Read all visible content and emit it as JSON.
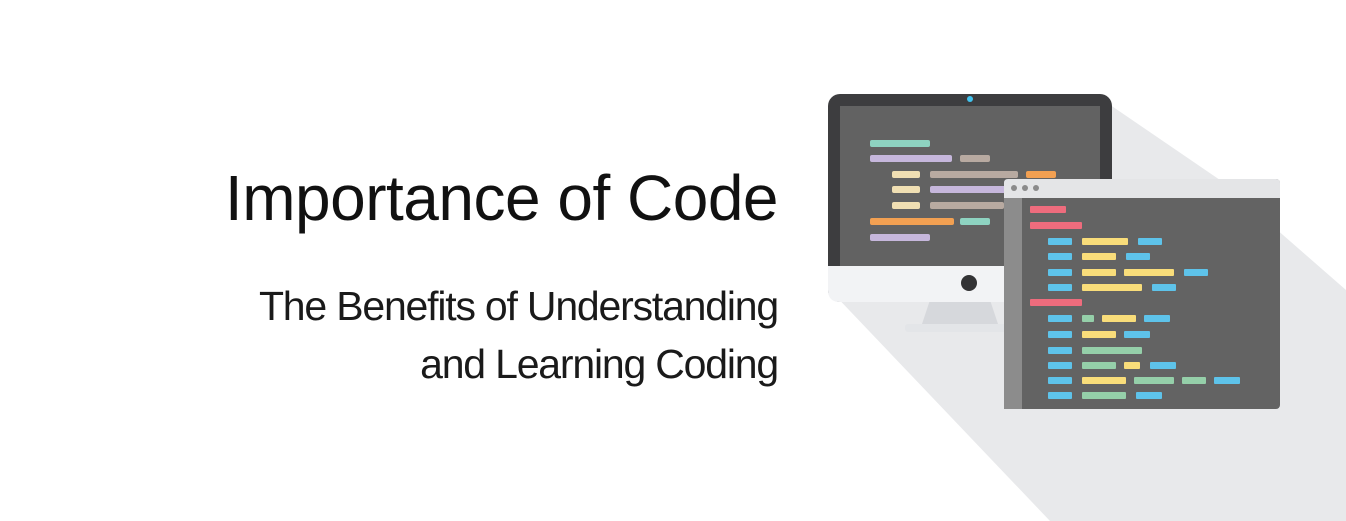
{
  "heading": {
    "title": "Importance of Code",
    "subtitle_line1": "The Benefits of Understanding",
    "subtitle_line2": "and Learning Coding"
  },
  "illustration": {
    "monitor_icon": "desktop-monitor-icon",
    "window_icon": "code-editor-window-icon",
    "colors": {
      "shadow": "#e8e9eb",
      "monitor_bezel": "#3d3d3f",
      "screen": "#626262",
      "monitor_chin": "#f2f3f5",
      "window_bar": "#e4e5e7",
      "window_body": "#636363",
      "code_teal": "#8ed3c1",
      "code_lavender": "#c6b7dc",
      "code_tan": "#b8aaa1",
      "code_cream": "#f0dfb3",
      "code_orange": "#f2a052",
      "code_red": "#ee6c7d",
      "code_blue": "#5ec3ea",
      "code_yellow": "#f9dd7a",
      "code_green": "#95cfa9"
    }
  }
}
